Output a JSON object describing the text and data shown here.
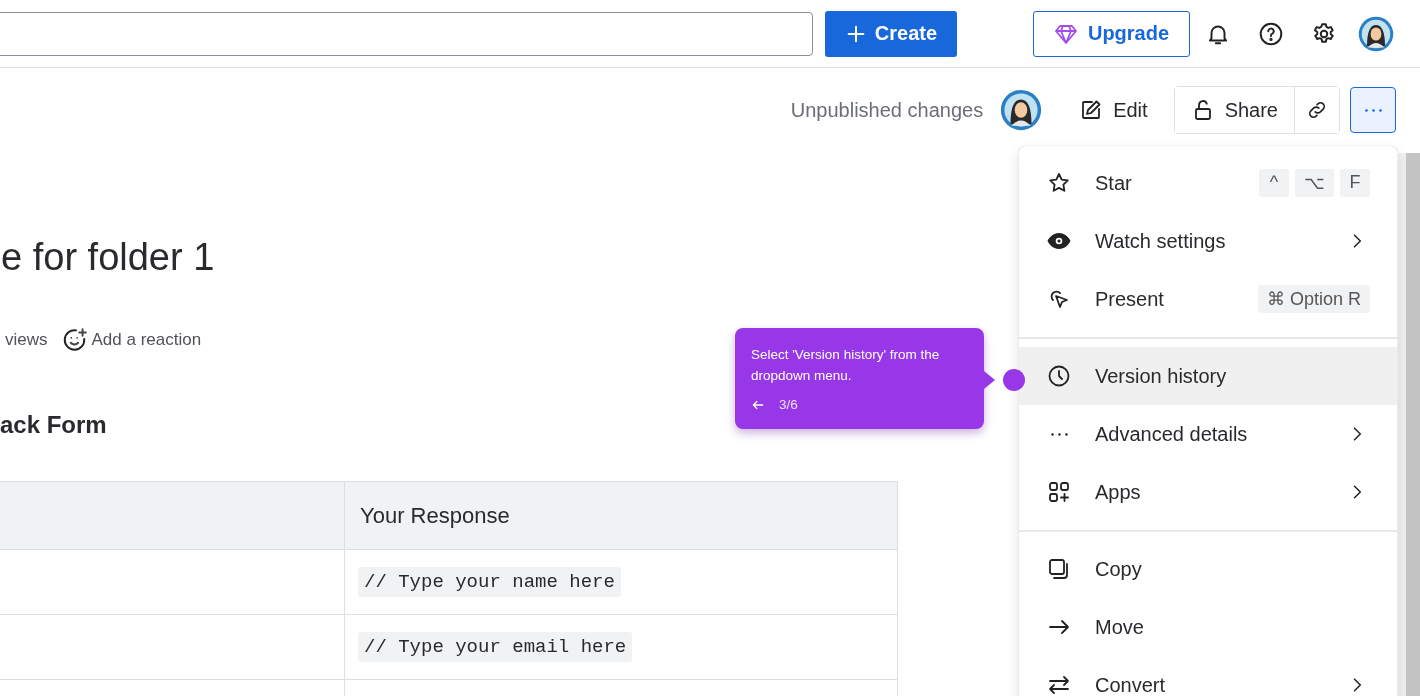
{
  "header": {
    "create_button": "Create",
    "upgrade_button": "Upgrade"
  },
  "page_toolbar": {
    "status": "Unpublished changes",
    "edit_button": "Edit",
    "share_button": "Share"
  },
  "page": {
    "title": "e for folder 1",
    "views": "views",
    "reaction": "Add a reaction",
    "heading": "ack Form"
  },
  "table": {
    "columns": [
      "Your Response"
    ],
    "rows": [
      {
        "response": "// Type your name here"
      },
      {
        "response": "// Type your email here"
      }
    ]
  },
  "menu": {
    "items": [
      {
        "kind": "item",
        "label": "Star",
        "shortcut": [
          "^",
          "⌥",
          "F"
        ],
        "submenu": false,
        "selected": false
      },
      {
        "kind": "item",
        "label": "Watch settings",
        "submenu": true,
        "selected": false
      },
      {
        "kind": "item",
        "label": "Present",
        "shortcut": [
          "⌘ Option R"
        ],
        "submenu": false,
        "selected": false
      },
      {
        "kind": "divider"
      },
      {
        "kind": "item",
        "label": "Version history",
        "submenu": false,
        "selected": true
      },
      {
        "kind": "item",
        "label": "Advanced details",
        "submenu": true,
        "selected": false
      },
      {
        "kind": "item",
        "label": "Apps",
        "submenu": true,
        "selected": false
      },
      {
        "kind": "divider"
      },
      {
        "kind": "item",
        "label": "Copy",
        "submenu": false,
        "selected": false
      },
      {
        "kind": "item",
        "label": "Move",
        "submenu": false,
        "selected": false
      },
      {
        "kind": "item",
        "label": "Convert",
        "submenu": true,
        "selected": false
      }
    ]
  },
  "tooltip": {
    "text": "Select 'Version history' from the dropdown menu.",
    "step": "3/6"
  }
}
